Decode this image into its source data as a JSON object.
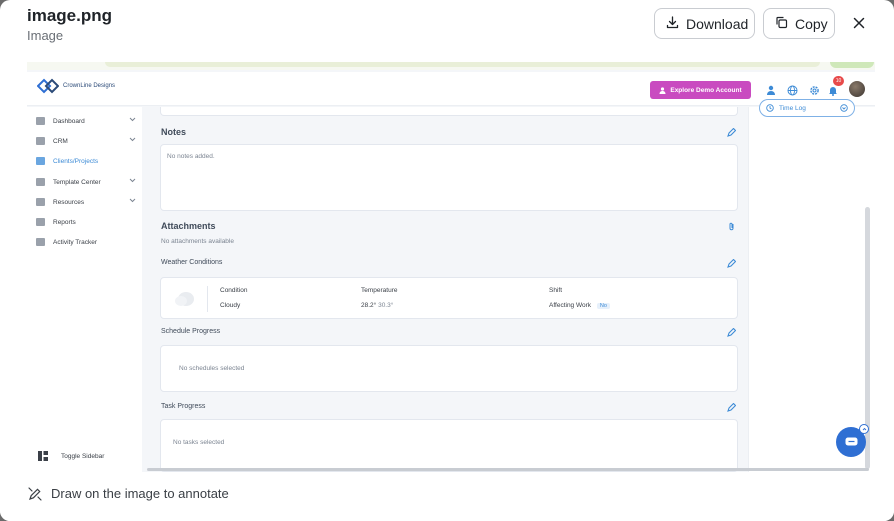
{
  "header": {
    "file_name": "image.png",
    "file_type": "Image",
    "download_label": "Download",
    "copy_label": "Copy",
    "close_icon": "close-icon"
  },
  "app": {
    "brand": "CrownLine Designs",
    "explore_label": "Explore Demo Account",
    "notification_count": "10",
    "sidebar": {
      "items": [
        {
          "label": "Dashboard",
          "icon": "dashboard-icon",
          "has_chevron": true
        },
        {
          "label": "CRM",
          "icon": "crm-icon",
          "has_chevron": true
        },
        {
          "label": "Clients/Projects",
          "icon": "clients-icon",
          "active": true
        },
        {
          "label": "Template Center",
          "icon": "template-icon",
          "has_chevron": true
        },
        {
          "label": "Resources",
          "icon": "resources-icon",
          "has_chevron": true
        },
        {
          "label": "Reports",
          "icon": "reports-icon"
        },
        {
          "label": "Activity Tracker",
          "icon": "activity-icon"
        }
      ],
      "toggle_label": "Toggle Sidebar"
    },
    "notes": {
      "title": "Notes",
      "empty": "No notes added."
    },
    "attachments": {
      "title": "Attachments",
      "empty": "No attachments available"
    },
    "weather": {
      "title": "Weather Conditions",
      "condition_label": "Condition",
      "condition_value": "Cloudy",
      "temperature_label": "Temperature",
      "temperature_high": "28.2°",
      "temperature_low": "30.3°",
      "shift_label": "Shift",
      "affecting_label": "Affecting Work",
      "affecting_value": "No"
    },
    "schedule": {
      "title": "Schedule Progress",
      "empty": "No schedules selected"
    },
    "tasks": {
      "title": "Task Progress",
      "empty": "No tasks selected"
    },
    "time_log_label": "Time Log"
  },
  "footer": {
    "annotate_label": "Draw on the image to annotate"
  },
  "colors": {
    "accent": "#3d8bd6",
    "explore": "#c94bc0",
    "fab": "#2f6fd3"
  }
}
